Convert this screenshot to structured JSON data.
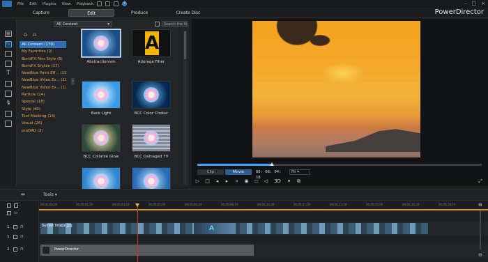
{
  "menubar": {
    "items": [
      "File",
      "Edit",
      "Plugins",
      "View",
      "Playback"
    ]
  },
  "modes": {
    "capture": "Capture",
    "edit": "Edit",
    "produce": "Produce",
    "create_disc": "Create Disc"
  },
  "brand": "PowerDirector",
  "library": {
    "filter": "All Content",
    "search_placeholder": "Search the library",
    "categories": [
      "All Content  (170)",
      "My Favorites  (0)",
      "BorisFX Film Style  (6)",
      "BorisFX Stylize  (17)",
      "NewBlue Paint Eff...  (12)",
      "NewBlue Video Es...  (10)",
      "NewBlue Video Es...  (12)",
      "Particle  (24)",
      "Special  (18)",
      "Style  (40)",
      "Text Masking  (16)",
      "Visual  (26)",
      "proDAD  (2)"
    ],
    "effects": [
      {
        "label": "Abstractionism"
      },
      {
        "label": "Adorage Filter"
      },
      {
        "label": "Back Light"
      },
      {
        "label": "BCC Color Choker"
      },
      {
        "label": "BCC Colorize Glow"
      },
      {
        "label": "BCC Damaged TV"
      },
      {
        "label": ""
      },
      {
        "label": ""
      }
    ]
  },
  "preview": {
    "clip_label": "Clip",
    "movie_label": "Movie",
    "timecode": "00: 00: 04: 18",
    "zoom": "Fit",
    "mode_3d": "3D"
  },
  "toolsbar": {
    "tools_label": "Tools"
  },
  "timeline": {
    "ruler": [
      "00;00;00;00",
      "00;00;01;20",
      "00;00;03;10",
      "00;00;05;00",
      "00;00;06;20",
      "00;00;08;10",
      "00;00;10;00",
      "00;00;11;20",
      "00;00;13;10",
      "00;00;15;00",
      "00;00;16;20",
      "00;00;18;10"
    ],
    "tracks": [
      {
        "label": "1."
      },
      {
        "label": "1."
      },
      {
        "label": "2."
      }
    ],
    "clip1_label": "Sunset Image.jpg",
    "clip1_title_glyph": "A",
    "clip2_label": "PowerDirector"
  }
}
